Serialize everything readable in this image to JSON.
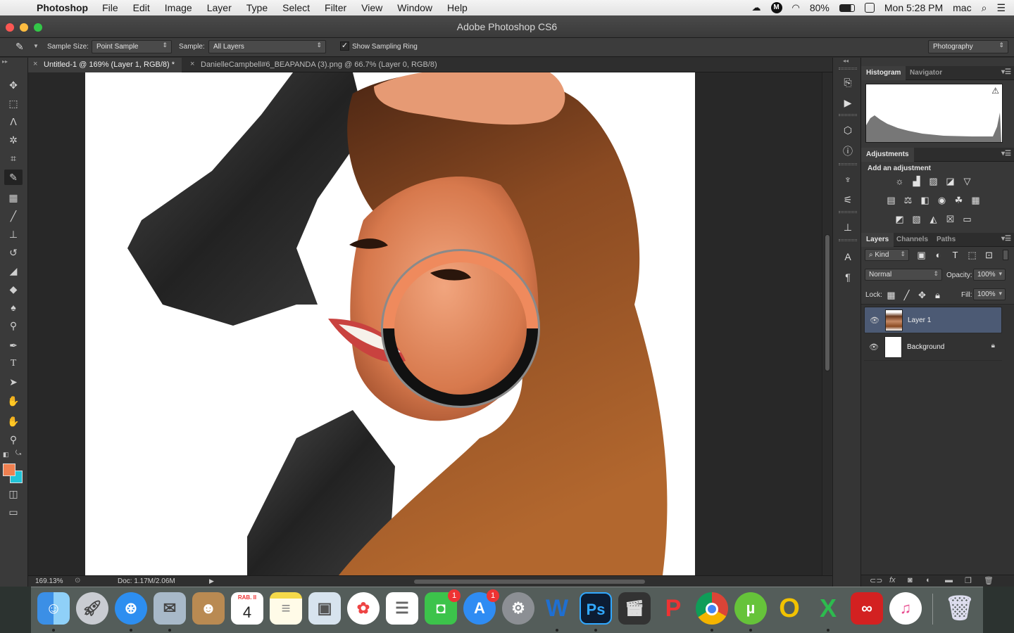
{
  "menubar": {
    "app_name": "Photoshop",
    "menus": [
      "File",
      "Edit",
      "Image",
      "Layer",
      "Type",
      "Select",
      "Filter",
      "View",
      "Window",
      "Help"
    ],
    "battery": "80%",
    "clock": "Mon 5:28 PM",
    "user": "mac"
  },
  "window": {
    "title": "Adobe Photoshop CS6"
  },
  "options": {
    "sample_size_label": "Sample Size:",
    "sample_size_value": "Point Sample",
    "sample_label": "Sample:",
    "sample_value": "All Layers",
    "show_ring_label": "Show Sampling Ring",
    "workspace": "Photography"
  },
  "tabs": [
    {
      "label": "Untitled-1 @ 169% (Layer 1, RGB/8) *",
      "active": true
    },
    {
      "label": "DanielleCampbell#6_BEAPANDA (3).png @ 66.7% (Layer 0, RGB/8)",
      "active": false
    }
  ],
  "status": {
    "zoom": "169.13%",
    "doc": "Doc: 1.17M/2.06M"
  },
  "panels": {
    "top_tabs": [
      "Histogram",
      "Navigator"
    ],
    "adjustments_title": "Adjustments",
    "adjustments_subtitle": "Add an adjustment",
    "layers_tabs": [
      "Layers",
      "Channels",
      "Paths"
    ],
    "filter_kind": "Kind",
    "blend_mode": "Normal",
    "opacity_label": "Opacity:",
    "opacity_value": "100%",
    "lock_label": "Lock:",
    "fill_label": "Fill:",
    "fill_value": "100%",
    "layers": [
      {
        "name": "Layer 1",
        "selected": true
      },
      {
        "name": "Background",
        "selected": false
      }
    ]
  },
  "colors": {
    "foreground": "#f08050",
    "background": "#22c4d8",
    "ring_sample": "#ef8a5d"
  },
  "dock": {
    "calendar_month": "RAB. II",
    "calendar_day": "4",
    "facetime_badge": "1",
    "appstore_badge": "1"
  }
}
